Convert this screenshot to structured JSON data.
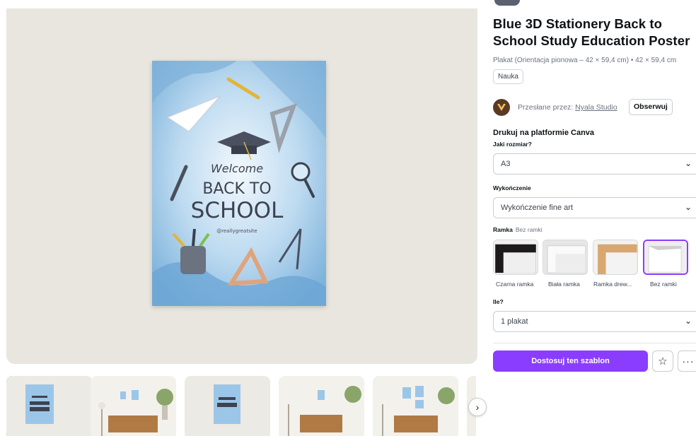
{
  "poster": {
    "welcome": "Welcome",
    "back_to": "BACK TO",
    "school": "SCHOOL",
    "handle": "@reallygreatsite"
  },
  "thumbnails": [
    {
      "name": "poster-front",
      "selected": true
    },
    {
      "name": "living-room-1",
      "selected": false
    },
    {
      "name": "poster-closeup",
      "selected": false
    },
    {
      "name": "living-room-2",
      "selected": false
    },
    {
      "name": "living-room-3",
      "selected": false
    }
  ],
  "thumbs_next_icon": "chevron-right-icon",
  "product": {
    "title": "Blue 3D Stationery Back to School Study Education Poster",
    "subtitle": "Plakat (Orientacja pionowa – 42 × 59,4 cm) • 42 × 59,4 cm",
    "tag": "Nauka"
  },
  "author": {
    "prefix": "Przesłane przez: ",
    "name": "Nyala Studio",
    "follow": "Obserwuj"
  },
  "print": {
    "section_title": "Drukuj na platformie Canva",
    "size_label": "Jaki rozmiar?",
    "size_value": "A3",
    "finish_label": "Wykończenie",
    "finish_value": "Wykończenie fine art",
    "frame_label": "Ramka",
    "frame_value": "Bez ramki",
    "frames": [
      {
        "label": "Czarna ramka",
        "selected": false
      },
      {
        "label": "Biała ramka",
        "selected": false
      },
      {
        "label": "Ramka drew...",
        "selected": false
      },
      {
        "label": "Bez ramki",
        "selected": true
      }
    ],
    "qty_label": "Ile?",
    "qty_value": "1 plakat"
  },
  "actions": {
    "customize": "Dostosuj ten szablon",
    "star_icon": "star-icon",
    "more_icon": "more-icon"
  },
  "colors": {
    "accent": "#8b3dff",
    "poster_blue": "#8ec0e4",
    "preview_bg": "#e8e6df"
  }
}
